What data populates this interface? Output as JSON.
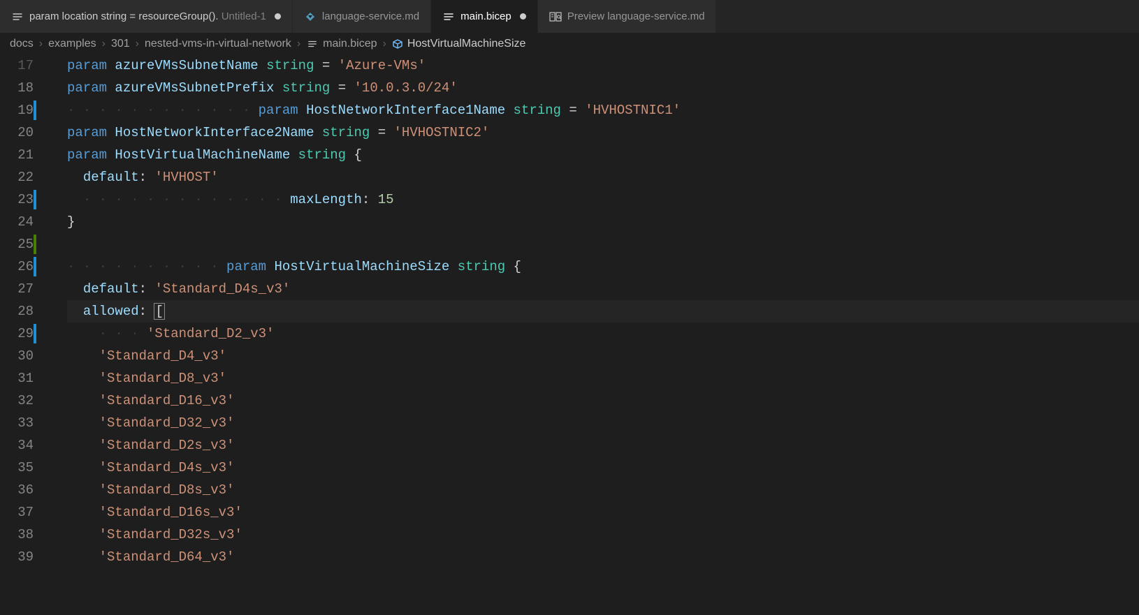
{
  "tabs": [
    {
      "label_prefix": "param location string = resourceGroup(). ",
      "label_suffix": "Untitled-1",
      "modified": true,
      "icon": "list"
    },
    {
      "label": "language-service.md",
      "icon": "markdown",
      "modified": false
    },
    {
      "label": "main.bicep",
      "icon": "bicep",
      "modified": true,
      "active": true
    },
    {
      "label": "Preview language-service.md",
      "icon": "preview",
      "modified": false
    }
  ],
  "breadcrumbs": {
    "parts": [
      "docs",
      "examples",
      "301",
      "nested-vms-in-virtual-network",
      "main.bicep",
      "HostVirtualMachineSize"
    ]
  },
  "editor": {
    "startLine": 17,
    "currentLine": 28,
    "modLines": [
      19,
      23,
      26,
      29
    ],
    "addLineRanges": [
      [
        25,
        25
      ]
    ],
    "lines": [
      {
        "n": 17,
        "dim": true,
        "segs": [
          [
            "kw",
            "param"
          ],
          [
            "sp",
            " "
          ],
          [
            "ident",
            "azureVMsSubnetName"
          ],
          [
            "sp",
            " "
          ],
          [
            "type",
            "string"
          ],
          [
            "sp",
            " "
          ],
          [
            "op",
            "="
          ],
          [
            "sp",
            " "
          ],
          [
            "str",
            "'Azure-VMs'"
          ]
        ]
      },
      {
        "n": 18,
        "segs": [
          [
            "kw",
            "param"
          ],
          [
            "sp",
            " "
          ],
          [
            "ident",
            "azureVMsSubnetPrefix"
          ],
          [
            "sp",
            " "
          ],
          [
            "type",
            "string"
          ],
          [
            "sp",
            " "
          ],
          [
            "op",
            "="
          ],
          [
            "sp",
            " "
          ],
          [
            "str",
            "'10.0.3.0/24'"
          ]
        ]
      },
      {
        "n": 19,
        "segs": [
          [
            "ws",
            12
          ],
          [
            "kw",
            "param"
          ],
          [
            "sp",
            " "
          ],
          [
            "ident",
            "HostNetworkInterface1Name"
          ],
          [
            "sp",
            " "
          ],
          [
            "type",
            "string"
          ],
          [
            "sp",
            " "
          ],
          [
            "op",
            "="
          ],
          [
            "sp",
            " "
          ],
          [
            "str",
            "'HVHOSTNIC1'"
          ]
        ]
      },
      {
        "n": 20,
        "segs": [
          [
            "kw",
            "param"
          ],
          [
            "sp",
            " "
          ],
          [
            "ident",
            "HostNetworkInterface2Name"
          ],
          [
            "sp",
            " "
          ],
          [
            "type",
            "string"
          ],
          [
            "sp",
            " "
          ],
          [
            "op",
            "="
          ],
          [
            "sp",
            " "
          ],
          [
            "str",
            "'HVHOSTNIC2'"
          ]
        ]
      },
      {
        "n": 21,
        "segs": [
          [
            "kw",
            "param"
          ],
          [
            "sp",
            " "
          ],
          [
            "ident",
            "HostVirtualMachineName"
          ],
          [
            "sp",
            " "
          ],
          [
            "type",
            "string"
          ],
          [
            "sp",
            " "
          ],
          [
            "punc",
            "{"
          ]
        ]
      },
      {
        "n": 22,
        "segs": [
          [
            "sp",
            "  "
          ],
          [
            "prop",
            "default"
          ],
          [
            "punc",
            ":"
          ],
          [
            "sp",
            " "
          ],
          [
            "str",
            "'HVHOST'"
          ]
        ]
      },
      {
        "n": 23,
        "segs": [
          [
            "sp",
            "  "
          ],
          [
            "ws",
            13
          ],
          [
            "prop",
            "maxLength"
          ],
          [
            "punc",
            ":"
          ],
          [
            "sp",
            " "
          ],
          [
            "num",
            "15"
          ]
        ]
      },
      {
        "n": 24,
        "segs": [
          [
            "punc",
            "}"
          ]
        ]
      },
      {
        "n": 25,
        "segs": []
      },
      {
        "n": 26,
        "segs": [
          [
            "ws",
            10
          ],
          [
            "kw",
            "param"
          ],
          [
            "sp",
            " "
          ],
          [
            "ident",
            "HostVirtualMachineSize"
          ],
          [
            "sp",
            " "
          ],
          [
            "type",
            "string"
          ],
          [
            "sp",
            " "
          ],
          [
            "punc",
            "{"
          ]
        ]
      },
      {
        "n": 27,
        "segs": [
          [
            "sp",
            "  "
          ],
          [
            "prop",
            "default"
          ],
          [
            "punc",
            ":"
          ],
          [
            "sp",
            " "
          ],
          [
            "str",
            "'Standard_D4s_v3'"
          ]
        ]
      },
      {
        "n": 28,
        "segs": [
          [
            "sp",
            "  "
          ],
          [
            "prop",
            "allowed"
          ],
          [
            "punc",
            ":"
          ],
          [
            "sp",
            " "
          ],
          [
            "bracket",
            "["
          ]
        ]
      },
      {
        "n": 29,
        "segs": [
          [
            "sp",
            "    "
          ],
          [
            "ws",
            3
          ],
          [
            "str",
            "'Standard_D2_v3'"
          ]
        ]
      },
      {
        "n": 30,
        "segs": [
          [
            "sp",
            "    "
          ],
          [
            "str",
            "'Standard_D4_v3'"
          ]
        ]
      },
      {
        "n": 31,
        "segs": [
          [
            "sp",
            "    "
          ],
          [
            "str",
            "'Standard_D8_v3'"
          ]
        ]
      },
      {
        "n": 32,
        "segs": [
          [
            "sp",
            "    "
          ],
          [
            "str",
            "'Standard_D16_v3'"
          ]
        ]
      },
      {
        "n": 33,
        "segs": [
          [
            "sp",
            "    "
          ],
          [
            "str",
            "'Standard_D32_v3'"
          ]
        ]
      },
      {
        "n": 34,
        "segs": [
          [
            "sp",
            "    "
          ],
          [
            "str",
            "'Standard_D2s_v3'"
          ]
        ]
      },
      {
        "n": 35,
        "segs": [
          [
            "sp",
            "    "
          ],
          [
            "str",
            "'Standard_D4s_v3'"
          ]
        ]
      },
      {
        "n": 36,
        "segs": [
          [
            "sp",
            "    "
          ],
          [
            "str",
            "'Standard_D8s_v3'"
          ]
        ]
      },
      {
        "n": 37,
        "segs": [
          [
            "sp",
            "    "
          ],
          [
            "str",
            "'Standard_D16s_v3'"
          ]
        ]
      },
      {
        "n": 38,
        "segs": [
          [
            "sp",
            "    "
          ],
          [
            "str",
            "'Standard_D32s_v3'"
          ]
        ]
      },
      {
        "n": 39,
        "segs": [
          [
            "sp",
            "    "
          ],
          [
            "str",
            "'Standard_D64_v3'"
          ]
        ]
      }
    ]
  },
  "colors": {
    "markdown": "#519aba",
    "bicep": "#d4d4d4"
  }
}
